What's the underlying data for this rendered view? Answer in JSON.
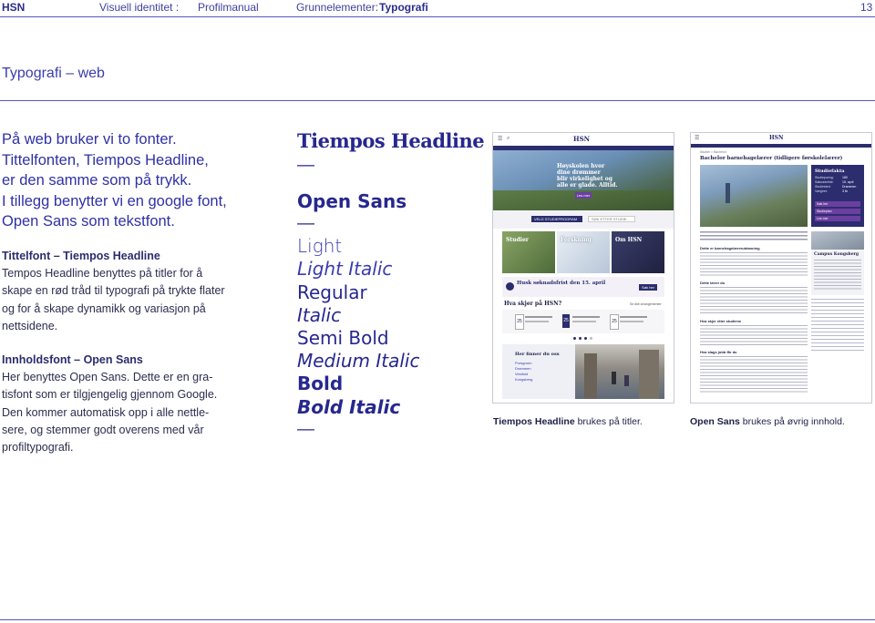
{
  "header": {
    "brand": "HSN",
    "doc_title": "Visuell identitet :",
    "doc_sub": "Profilmanual",
    "section": "Grunnelementer:",
    "section_name": "Typografi",
    "page": "13"
  },
  "title": "Typografi – web",
  "intro": [
    "På web bruker vi to fonter.",
    "Tittelfonten, Tiempos Headline,",
    "er den samme som på trykk.",
    "I tillegg benytter vi en google font,",
    "Open Sans som tekstfont."
  ],
  "title_font": {
    "heading": "Tittelfont – Tiempos Headline",
    "lines": [
      "Tempos Headline benyttes på titler for å",
      "skape en rød tråd til typografi på trykte flater",
      "og for å skape dynamikk og variasjon på",
      "nettsidene."
    ]
  },
  "body_font": {
    "heading": "Innholdsfont – Open Sans",
    "lines": [
      "Her benyttes Open Sans. Dette er en gra-",
      "tisfont som er tilgjengelig gjennom Google.",
      "Den kommer automatisk opp i alle nettle-",
      "sere, og stemmer godt overens med vår",
      "profiltypografi."
    ]
  },
  "samples": {
    "tiempos": "Tiempos Headline",
    "dash": "—",
    "opensans": "Open Sans",
    "weights": [
      "Light",
      "Light Italic",
      "Regular",
      "Italic",
      "Semi Bold",
      "Medium Italic",
      "Bold",
      "Bold Italic"
    ]
  },
  "shot_left": {
    "logo": "HSN",
    "hero_text": [
      "Høyskolen hvor",
      "dine drømmer",
      "blir virkelighet og",
      "alle er glade. Alltid."
    ],
    "cta": "Les mer",
    "select1": "VELG STUDIEPROGRAM",
    "select2": "SØK ETTER STUDIE...",
    "tiles": [
      "Studier",
      "Forskning",
      "Om HSN"
    ],
    "notice": "Husk søknadsfrist den 15. april",
    "notice_btn": "Søk her",
    "events_title": "Hva skjer på HSN?",
    "events_link": "Se alle arrangementer",
    "event_days": [
      "25",
      "25",
      "25"
    ],
    "find_title": "Her finner du oss",
    "find_items": [
      "Porsgrunn",
      "Drammen",
      "Vestfold",
      "Kongsberg"
    ]
  },
  "shot_right": {
    "logo": "HSN",
    "breadcrumb": "Studier > Bachelor",
    "page_title": "Bachelor barnehagelærer (tidligere førskolelærer)",
    "facts_title": "Studiefakta",
    "facts_labels": [
      "Studiepoeng:",
      "Søknadsfrist:",
      "Studiested:",
      "Varighet:"
    ],
    "facts_values": [
      "180",
      "15. april",
      "Drammen",
      "3 år"
    ],
    "facts_buttons": [
      "Søk her",
      "Studieplan",
      "Les mer"
    ],
    "sidebar_card_title": "Campus Kongsberg",
    "sections": [
      "Dette er barnehagelærerutdanning",
      "Dette lærer du",
      "Hva skjer etter studiene",
      "Hva slags jobb får du"
    ]
  },
  "captions": {
    "left_bold": "Tiempos Headline",
    "left_rest": " brukes på titler.",
    "right_bold": "Open Sans",
    "right_rest": " brukes på øvrig innhold."
  },
  "colors": {
    "brand": "#3a3cae",
    "text": "#1e1f47",
    "rule": "#5558b8",
    "site_navy": "#2b2d6e",
    "site_purple": "#6b3fa0"
  }
}
